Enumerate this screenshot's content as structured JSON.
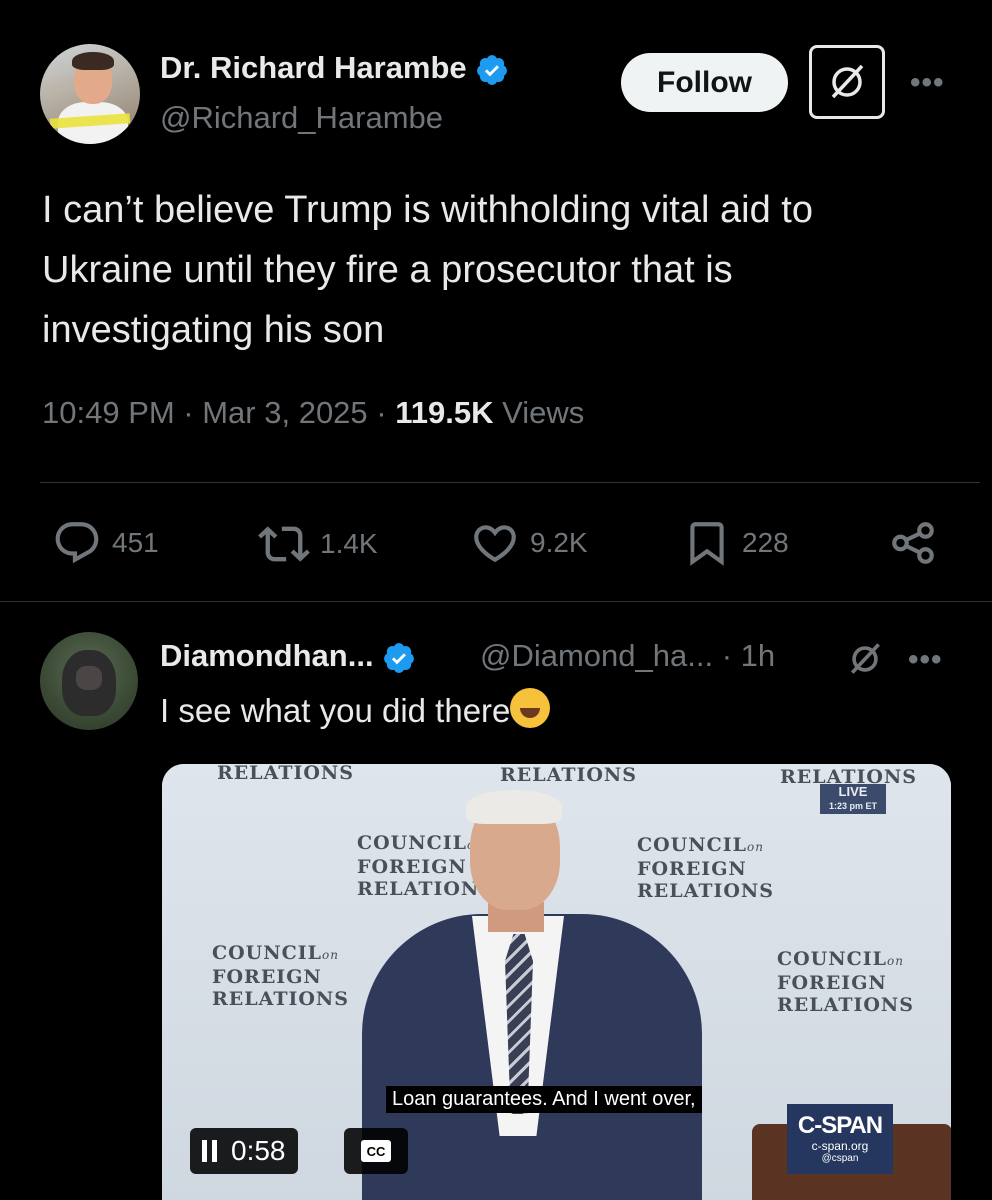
{
  "tweet": {
    "author_name": "Dr. Richard Harambe",
    "author_handle": "@Richard_Harambe",
    "follow_label": "Follow",
    "text": "I can’t believe Trump is withholding vital aid to Ukraine until they fire a prosecutor that is investigating his son",
    "time": "10:49 PM · Mar 3, 2025 · ",
    "views_count": "119.5K",
    "views_label": " Views",
    "icons": {
      "verified": "verified-badge-icon",
      "grok": "grok-icon",
      "more": "more-icon"
    }
  },
  "actions": {
    "replies": "451",
    "reposts": "1.4K",
    "likes": "9.2K",
    "bookmarks": "228"
  },
  "reply": {
    "author_name": "Diamondhan...",
    "author_handle": "@Diamond_ha...",
    "time": " · 1h",
    "text": "I see what you did there",
    "emoji": "rolling-on-floor-laughing"
  },
  "video": {
    "backdrop_word_1": "RELATIONS",
    "backdrop_word_2": "RELATIONS",
    "backdrop_word_3": "RELATIONS",
    "cfr_council": "COUNCIL",
    "cfr_on": "on",
    "cfr_foreign": "FOREIGN",
    "cfr_relations": "RELATIONS",
    "live_label": "LIVE",
    "live_time": "1:23 pm ET",
    "caption": "Loan guarantees. And I went over,",
    "cspan_logo": "C-SPAN",
    "cspan_site": "c-span.org",
    "cspan_at": "@cspan",
    "time": "0:58",
    "cc_label": "CC"
  },
  "colors": {
    "accent": "#1d9bf0",
    "muted": "#71767b",
    "text": "#e7e9ea",
    "background": "#000000"
  }
}
